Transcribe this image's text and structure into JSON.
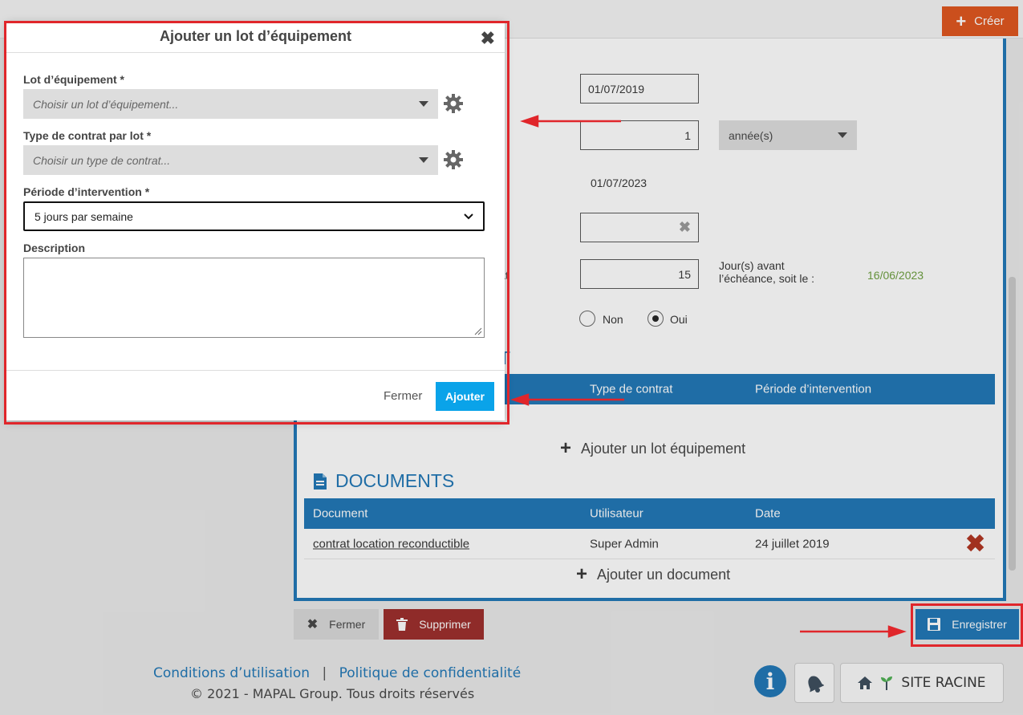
{
  "topbar": {
    "create_label": "Créer"
  },
  "background_form": {
    "start_date": "01/07/2019",
    "duration_value": "1",
    "duration_unit": "année(s)",
    "end_date": "01/07/2023",
    "notice_days": "15",
    "notice_label_line1": "Jour(s) avant",
    "notice_label_line2": "l’échéance, soit le :",
    "notice_date": "16/06/2023",
    "partial_label_at": "at",
    "partial_heading_t": "T",
    "radio_no": "Non",
    "radio_yes": "Oui",
    "radio_selected": "Oui"
  },
  "lots_table": {
    "columns": [
      "Type de contrat",
      "Période d’intervention"
    ],
    "add_label": "Ajouter un lot équipement"
  },
  "documents": {
    "title": "DOCUMENTS",
    "columns": [
      "Document",
      "Utilisateur",
      "Date"
    ],
    "rows": [
      {
        "document": "contrat location reconductible",
        "user": "Super Admin",
        "date": "24 juillet 2019"
      }
    ],
    "add_label": "Ajouter un document"
  },
  "bottom_actions": {
    "close_label": "Fermer",
    "delete_label": "Supprimer",
    "save_label": "Enregistrer"
  },
  "footer": {
    "terms": "Conditions d’utilisation",
    "separator": "|",
    "privacy": "Politique de confidentialité",
    "copyright": "© 2021 - MAPAL Group. Tous droits réservés",
    "site_label": "SITE RACINE"
  },
  "modal": {
    "title": "Ajouter un lot d’équipement",
    "lot_label": "Lot d’équipement *",
    "lot_placeholder": "Choisir un lot d’équipement...",
    "contract_label": "Type de contrat par lot *",
    "contract_placeholder": "Choisir un type de contrat...",
    "period_label": "Période d’intervention *",
    "period_value": "5 jours par semaine",
    "description_label": "Description",
    "description_value": "",
    "close_label": "Fermer",
    "submit_label": "Ajouter"
  },
  "colors": {
    "primary": "#1c75b5",
    "accent_create": "#e0531a",
    "delete": "#9b2a27",
    "submit": "#0aa3e9",
    "annotation": "#e0262b",
    "notice_date": "#6a9e3c"
  }
}
